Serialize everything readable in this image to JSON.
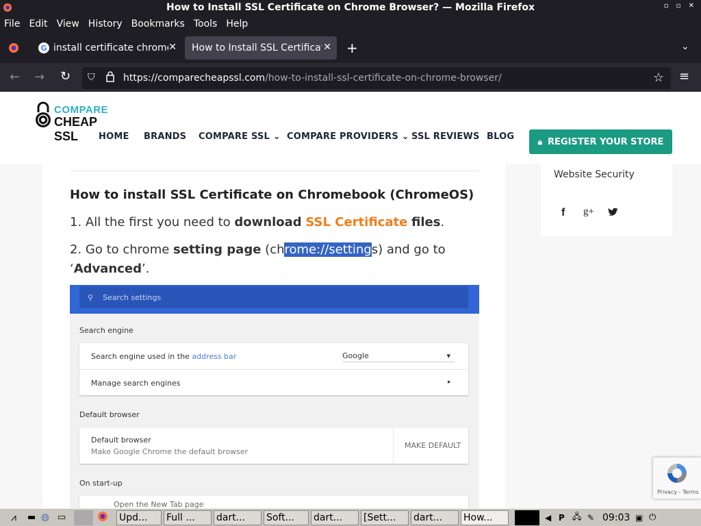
{
  "window": {
    "title": "How to Install SSL Certificate on Chrome Browser? — Mozilla Firefox",
    "controls": "▫ ▫ ✕"
  },
  "menu": [
    "File",
    "Edit",
    "View",
    "History",
    "Bookmarks",
    "Tools",
    "Help"
  ],
  "tabs": [
    {
      "label": "install certificate chrome"
    },
    {
      "label": "How to Install SSL Certificate"
    }
  ],
  "url": {
    "domain": "https://comparecheapssl.com",
    "path": "/how-to-install-ssl-certificate-on-chrome-browser/"
  },
  "site": {
    "logo_top": "COMPARE",
    "logo_bottom": "CHEAP SSL",
    "nav": [
      "HOME",
      "BRANDS",
      "COMPARE SSL",
      "COMPARE PROVIDERS",
      "SSL REVIEWS",
      "BLOG"
    ],
    "register": "REGISTER YOUR STORE",
    "sidebar_link": "Website Security"
  },
  "article": {
    "heading": "How to install SSL Certificate on Chromebook (ChromeOS)",
    "step1": {
      "prefix": "1. All the first you need to ",
      "bold": "download",
      "link": "SSL Certificate",
      "suffix": "files",
      "end": "."
    },
    "step2": {
      "prefix": "2. Go to chrome ",
      "bold": "setting page",
      "mid1": " (ch",
      "highlight": "rome://setting",
      "mid2": "s) and go to",
      "q1": "‘",
      "advanced": "Advanced",
      "q2": "’."
    }
  },
  "shot": {
    "search_placeholder": "Search settings",
    "section1": "Search engine",
    "row1": "Search engine used in the ",
    "row1_link": "address bar",
    "row1_value": "Google",
    "row2": "Manage search engines",
    "section2": "Default browser",
    "row3_title": "Default browser",
    "row3_sub": "Make Google Chrome the default browser",
    "row3_btn": "MAKE DEFAULT",
    "section3": "On start-up",
    "row4": "Open the New Tab page"
  },
  "recaptcha": "Privacy - Terms",
  "taskbar": {
    "items": [
      "Upd...",
      "Full ...",
      "dart...",
      "Soft...",
      "dart...",
      "[Sett...",
      "dart...",
      "How..."
    ],
    "clock": "09:03"
  }
}
